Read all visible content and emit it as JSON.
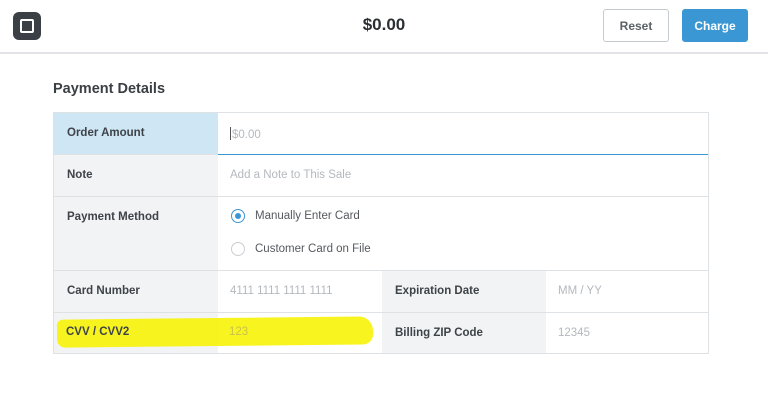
{
  "header": {
    "logo_icon": "square-logo-icon",
    "amount": "$0.00",
    "reset_label": "Reset",
    "charge_label": "Charge",
    "accent_color": "#3b97d3"
  },
  "payment_details": {
    "title": "Payment Details",
    "order_amount": {
      "label": "Order Amount",
      "placeholder": "$0.00"
    },
    "note": {
      "label": "Note",
      "placeholder": "Add a Note to This Sale"
    },
    "payment_method": {
      "label": "Payment Method",
      "options": [
        {
          "label": "Manually Enter Card",
          "selected": true
        },
        {
          "label": "Customer Card on File",
          "selected": false
        }
      ]
    },
    "card_number": {
      "label": "Card Number",
      "placeholder": "4111 1111 1111 1111"
    },
    "expiration_date": {
      "label": "Expiration Date",
      "placeholder": "MM / YY"
    },
    "cvv": {
      "label": "CVV / CVV2",
      "placeholder": "123"
    },
    "billing_zip": {
      "label": "Billing ZIP Code",
      "placeholder": "12345"
    }
  },
  "annotation": {
    "highlight_color": "#f7f300"
  }
}
